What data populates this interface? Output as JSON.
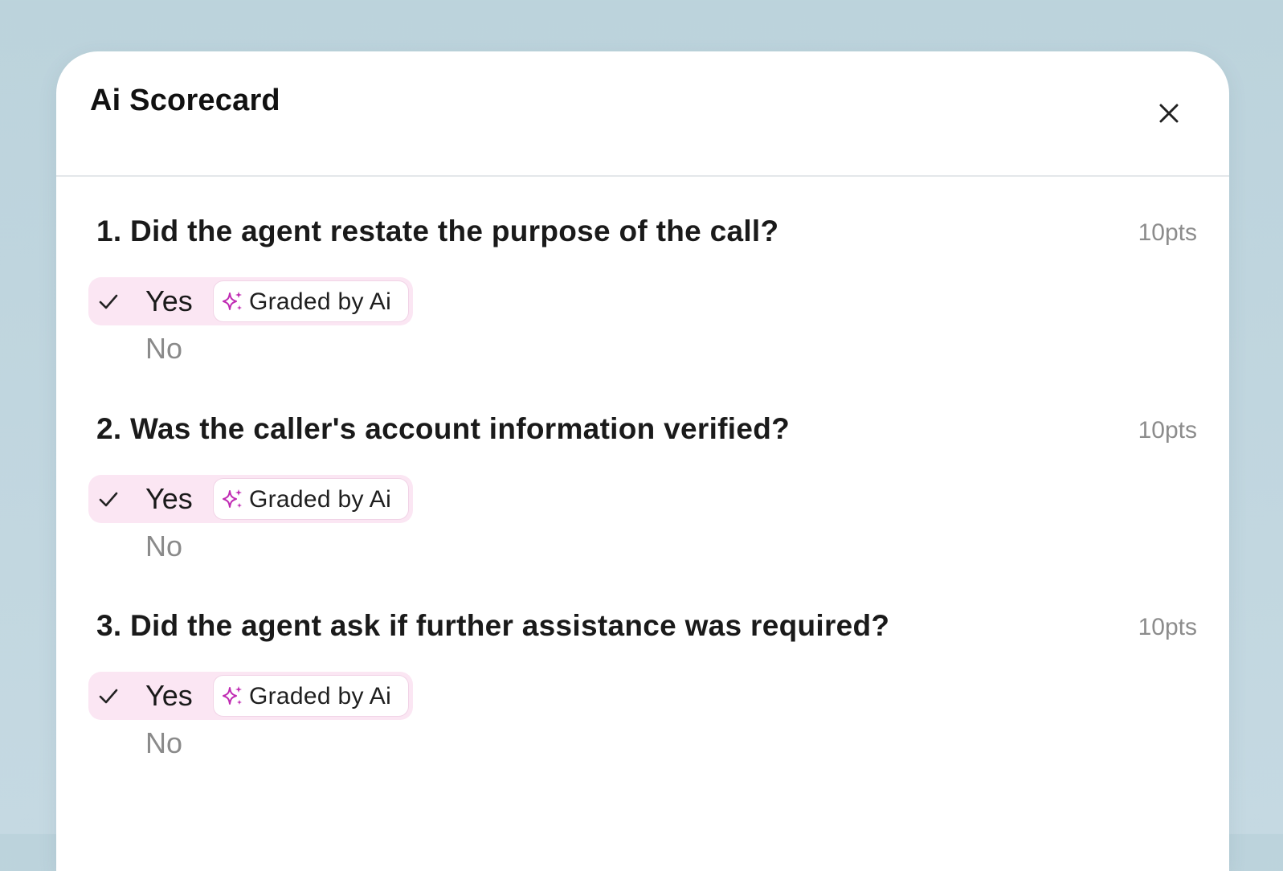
{
  "dialog": {
    "title": "Ai Scorecard",
    "close_icon": "close-icon"
  },
  "questions": [
    {
      "label": "1. Did the agent restate the purpose of the call?",
      "points": "10pts",
      "selected": "Yes",
      "options": {
        "yes": "Yes",
        "no": "No"
      },
      "badge": "Graded by Ai"
    },
    {
      "label": "2. Was the caller's account information verified?",
      "points": "10pts",
      "selected": "Yes",
      "options": {
        "yes": "Yes",
        "no": "No"
      },
      "badge": "Graded by Ai"
    },
    {
      "label": "3. Did the agent ask if further assistance was required?",
      "points": "10pts",
      "selected": "Yes",
      "options": {
        "yes": "Yes",
        "no": "No"
      },
      "badge": "Graded by Ai"
    }
  ],
  "icons": {
    "check": "check-icon",
    "sparkle": "sparkle-icon"
  },
  "colors": {
    "background": "#bcd3dc",
    "selected_option_bg": "#fbe6f3",
    "sparkle_accent": "#c02bb3",
    "muted_text": "#8a8a8a"
  }
}
